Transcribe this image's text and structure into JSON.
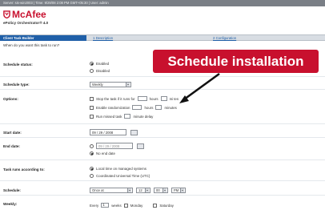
{
  "status_bar": {
    "text": "Server: sis-win2003 | Time: 9/29/08 2:08 PM GMT+05:30 | User: admin"
  },
  "brand": {
    "name": "McAfee",
    "product": "ePolicy Orchestrator® 4.0"
  },
  "tabs": [
    {
      "label": "Client Task Builder"
    },
    {
      "label": "1 Description"
    },
    {
      "label": "2 Configuration"
    }
  ],
  "question": "When do you want this task to run?",
  "callout": {
    "text": "Schedule installation"
  },
  "colors": {
    "accent": "#c8102e",
    "tab_active": "#1f5fa8"
  },
  "form": {
    "schedule_status": {
      "label": "Schedule status:",
      "options": [
        "Enabled",
        "Disabled"
      ],
      "selected": "Enabled"
    },
    "schedule_type": {
      "label": "Schedule type:",
      "value": "Weekly"
    },
    "options": {
      "label": "Options:",
      "items": [
        {
          "before": "Stop the task if it runs for",
          "u1": "hours",
          "u2": "mi",
          "tail": "tes"
        },
        {
          "before": "Enable randomization",
          "u1": "hours",
          "u2": "minutes"
        },
        {
          "before": "Run missed task",
          "u1": "minute delay"
        }
      ]
    },
    "start_date": {
      "label": "Start date:",
      "value": "09 / 29 / 2008"
    },
    "end_date": {
      "label": "End date:",
      "value": "09 / 29 / 2008",
      "no_end": "No end date"
    },
    "time_zone": {
      "label": "Task runs according to:",
      "options": [
        "Local time on managed systems",
        "Coordinated Universal Time (UTC)"
      ],
      "selected": "Local time on managed systems"
    },
    "schedule": {
      "label": "Schedule:",
      "mode": "Once at",
      "hour": "12",
      "minute": "00",
      "ampm": "PM"
    },
    "weekly": {
      "label": "Weekly:",
      "every": "Every",
      "value": "1",
      "weeks": "weeks",
      "days": [
        "Monday",
        "Saturday"
      ]
    }
  }
}
